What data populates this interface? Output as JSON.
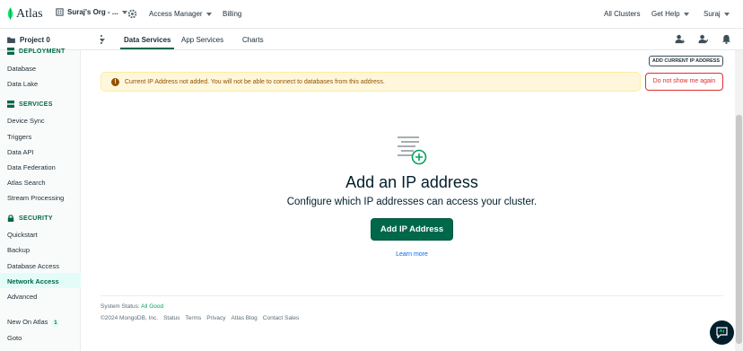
{
  "topbar": {
    "logo_text": "Atlas",
    "org_name": "Suraj's Org - ...",
    "access_manager": "Access Manager",
    "billing": "Billing",
    "all_clusters": "All Clusters",
    "get_help": "Get Help",
    "user": "Suraj"
  },
  "subbar": {
    "project": "Project 0",
    "tabs": [
      "Data Services",
      "App Services",
      "Charts"
    ],
    "active_tab": "Data Services"
  },
  "sidebar": {
    "deployment_header": "DEPLOYMENT",
    "deployment_items": [
      "Database",
      "Data Lake"
    ],
    "services_header": "SERVICES",
    "services_items": [
      "Device Sync",
      "Triggers",
      "Data API",
      "Data Federation",
      "Atlas Search",
      "Stream Processing"
    ],
    "security_header": "SECURITY",
    "security_items": [
      "Quickstart",
      "Backup",
      "Database Access",
      "Network Access",
      "Advanced"
    ],
    "active_item": "Network Access",
    "new_on_atlas": "New On Atlas",
    "new_count": "1",
    "goto": "Goto"
  },
  "main": {
    "add_current_ip": "ADD CURRENT IP ADDRESS",
    "banner_text": "Current IP Address not added. You will not be able to connect to databases from this address.",
    "dont_show": "Do not show me again",
    "title": "Add an IP address",
    "subtitle": "Configure which IP addresses can access your cluster.",
    "add_button": "Add IP Address",
    "learn_more": "Learn more"
  },
  "footer": {
    "status_label": "System Status:",
    "status_value": "All Good",
    "copyright": "©2024 MongoDB, Inc.",
    "links": [
      "Status",
      "Terms",
      "Privacy",
      "Atlas Blog",
      "Contact Sales"
    ]
  },
  "colors": {
    "brand_green": "#00684a",
    "warning_bg": "#fef7db",
    "danger": "#db3030",
    "link": "#016bf8"
  }
}
